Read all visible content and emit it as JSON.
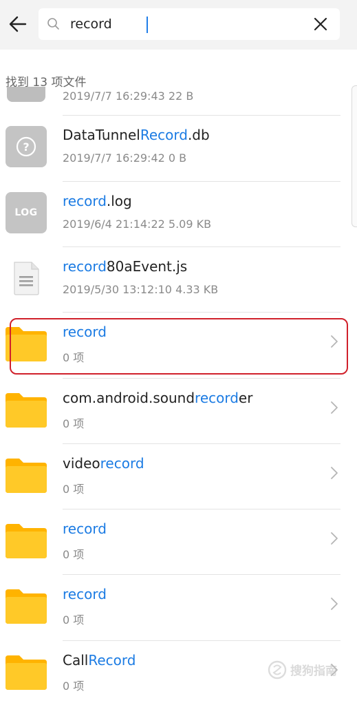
{
  "search": {
    "query": "record"
  },
  "results": {
    "count_text": "找到 13 项文件",
    "partial_meta": "2019/7/7 16:29:43 22 B"
  },
  "files": [
    {
      "icon": "unknown-file-icon",
      "name_prefix": "DataTunnel",
      "name_match": "Record",
      "name_suffix": ".db",
      "meta": "2019/7/7 16:29:42 0 B"
    },
    {
      "icon": "log-file-icon",
      "badge": "LOG",
      "name_prefix": "",
      "name_match": "record",
      "name_suffix": ".log",
      "meta": "2019/6/4 21:14:22 5.09 KB"
    },
    {
      "icon": "document-file-icon",
      "name_prefix": "",
      "name_match": "record",
      "name_suffix": "80aEvent.js",
      "meta": "2019/5/30 13:12:10 4.33 KB"
    },
    {
      "icon": "folder-icon",
      "name_prefix": "",
      "name_match": "record",
      "name_suffix": "",
      "meta": "0 项"
    },
    {
      "icon": "folder-icon",
      "name_prefix": "com.android.sound",
      "name_match": "record",
      "name_suffix": "er",
      "meta": "0 项"
    },
    {
      "icon": "folder-icon",
      "name_prefix": "video",
      "name_match": "record",
      "name_suffix": "",
      "meta": "0 项"
    },
    {
      "icon": "folder-icon",
      "name_prefix": "",
      "name_match": "record",
      "name_suffix": "",
      "meta": "0 项"
    },
    {
      "icon": "folder-icon",
      "name_prefix": "",
      "name_match": "record",
      "name_suffix": "",
      "meta": "0 项"
    },
    {
      "icon": "folder-icon",
      "name_prefix": "Call",
      "name_match": "Record",
      "name_suffix": "",
      "meta": "0 项"
    }
  ],
  "watermark": {
    "text": "搜狗指南"
  },
  "colors": {
    "highlight": "#1b7be3",
    "folder": "#ffc21e",
    "annotation": "#d0202a"
  }
}
